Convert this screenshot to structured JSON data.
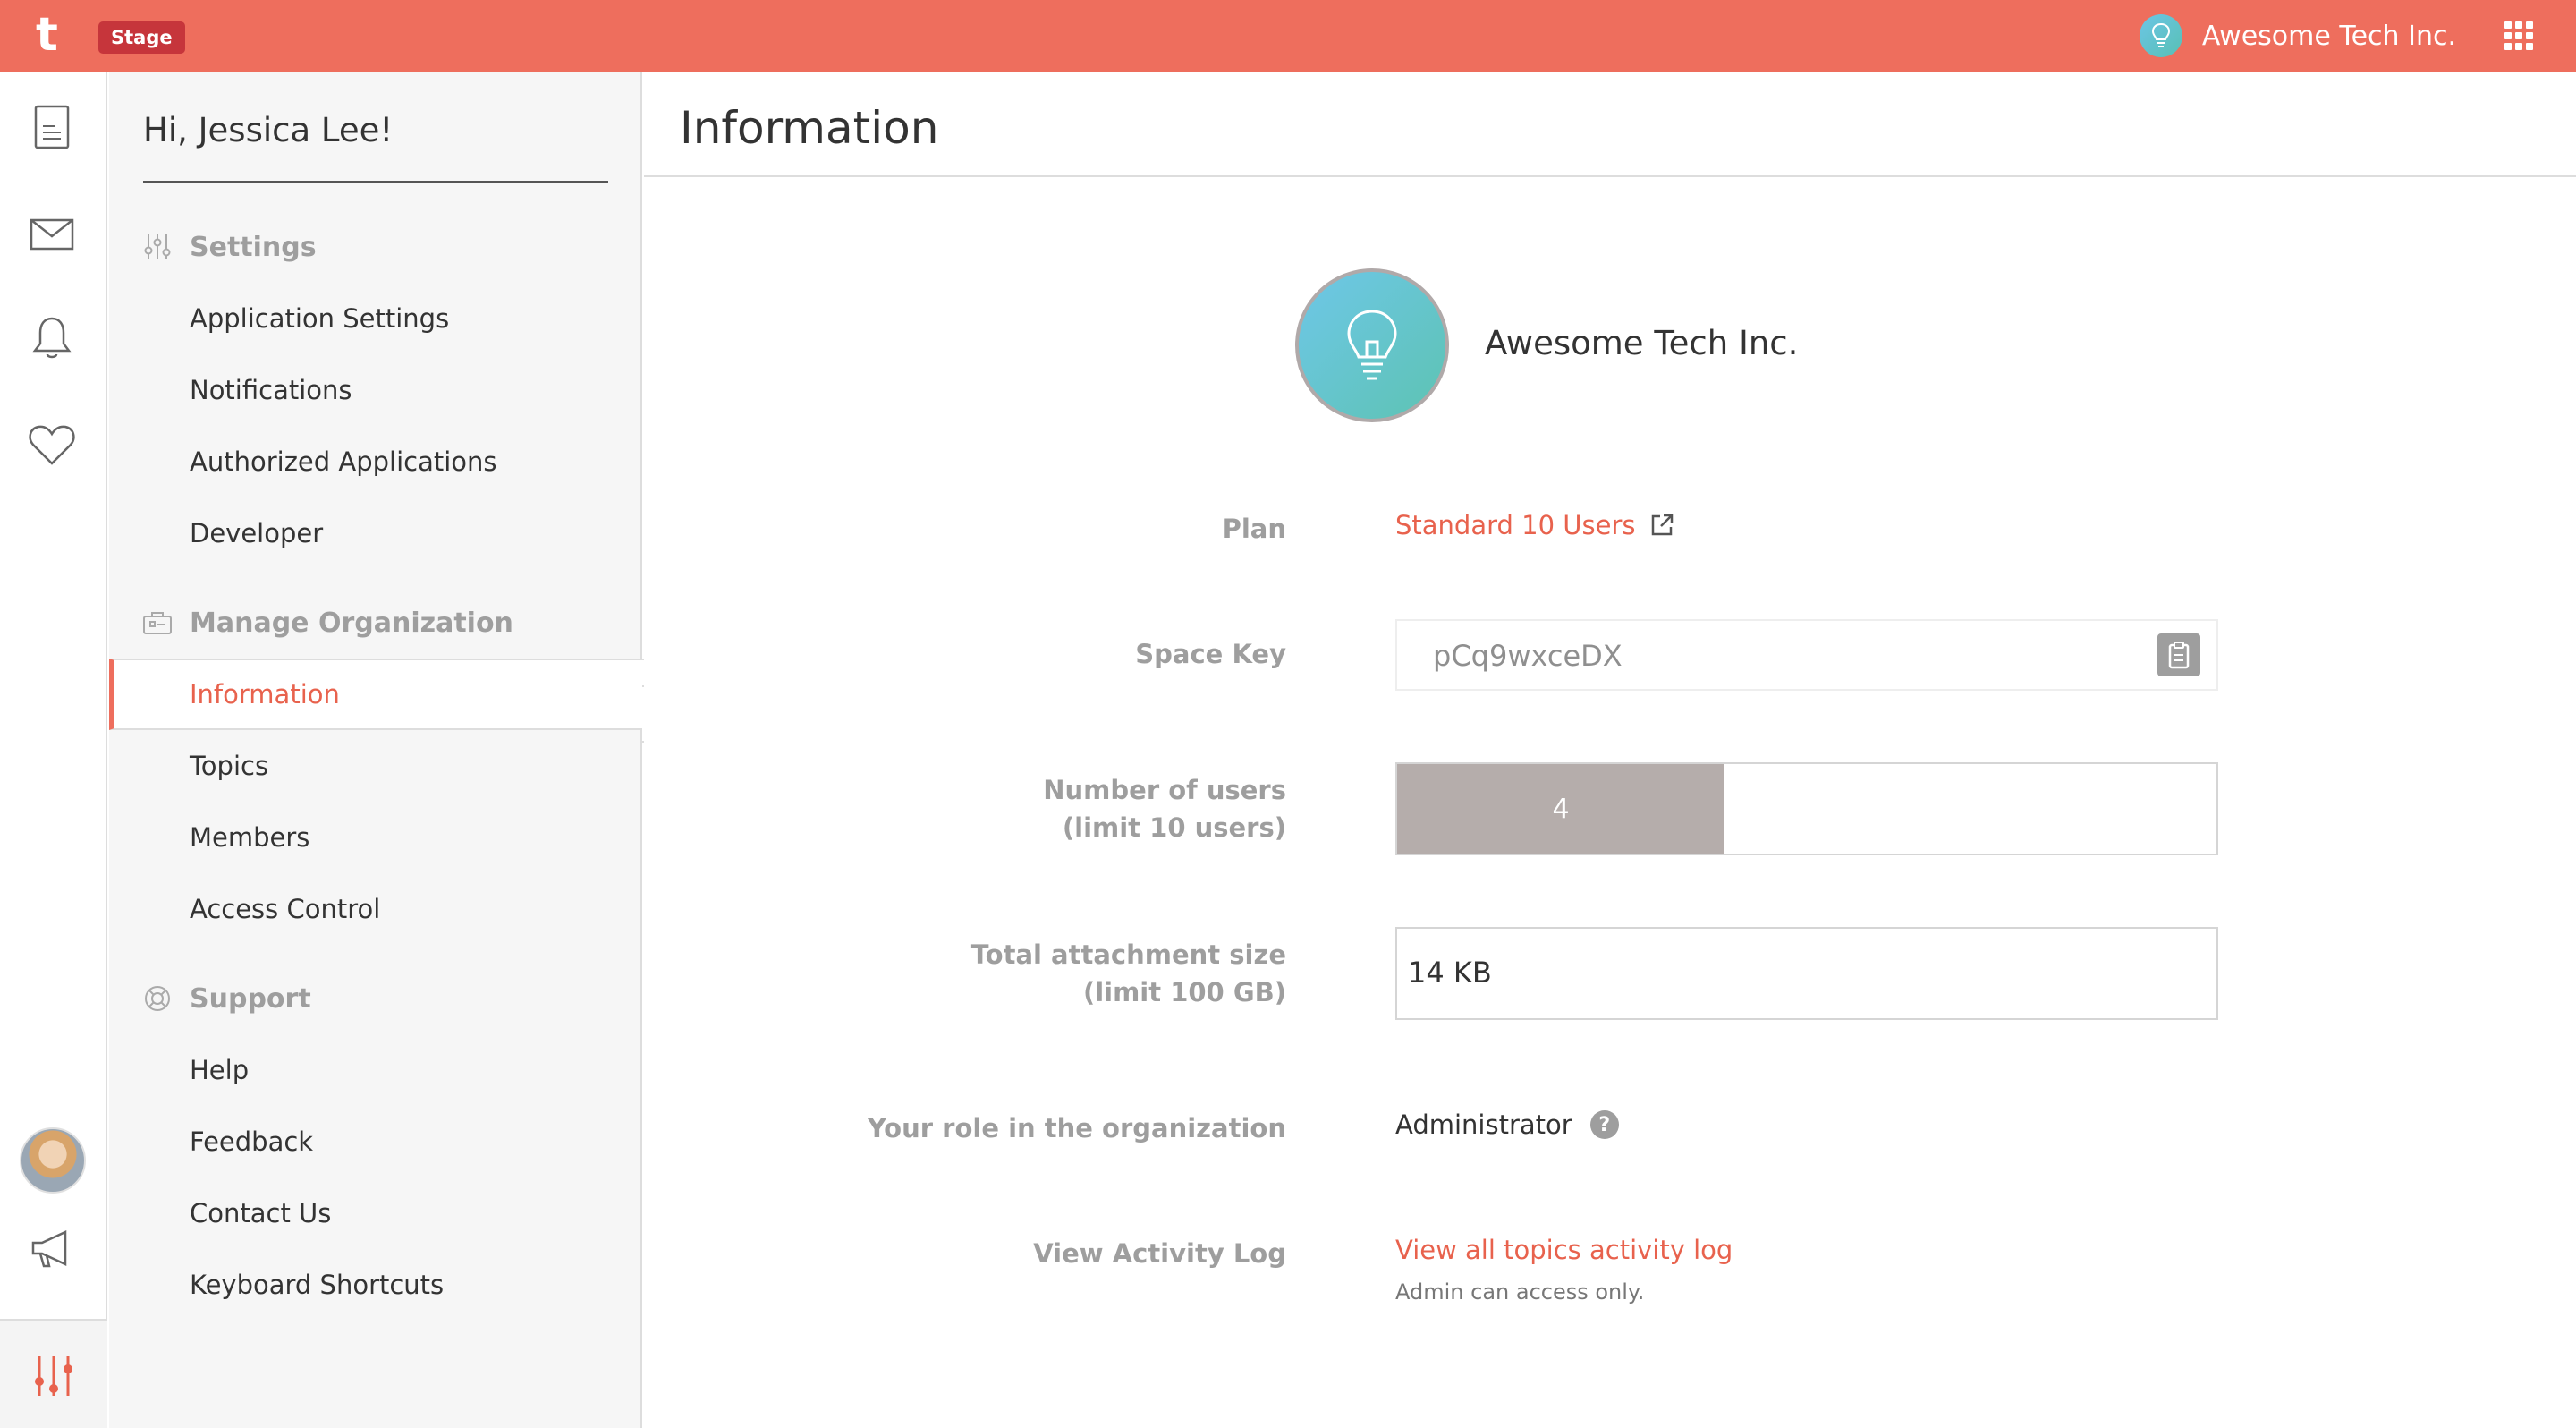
{
  "topbar": {
    "logo": "t",
    "env_badge": "Stage",
    "org_name": "Awesome Tech Inc."
  },
  "rail": {
    "icons": [
      "document-icon",
      "mail-icon",
      "bell-icon",
      "heart-icon",
      "megaphone-icon",
      "settings-sliders-icon"
    ]
  },
  "sidebar": {
    "greeting": "Hi, Jessica Lee!",
    "sections": [
      {
        "title": "Settings",
        "icon": "sliders-icon",
        "items": [
          "Application Settings",
          "Notifications",
          "Authorized Applications",
          "Developer"
        ]
      },
      {
        "title": "Manage Organization",
        "icon": "organization-icon",
        "items": [
          "Information",
          "Topics",
          "Members",
          "Access Control"
        ]
      },
      {
        "title": "Support",
        "icon": "lifebuoy-icon",
        "items": [
          "Help",
          "Feedback",
          "Contact Us",
          "Keyboard Shortcuts"
        ]
      }
    ],
    "active_item": "Information"
  },
  "main": {
    "title": "Information",
    "org_name": "Awesome Tech Inc.",
    "fields": {
      "plan": {
        "label": "Plan",
        "value": "Standard 10 Users"
      },
      "space_key": {
        "label": "Space Key",
        "value": "pCq9wxceDX"
      },
      "users": {
        "label_line1": "Number of users",
        "label_line2": "(limit 10 users)",
        "value": "4",
        "fraction": 0.4
      },
      "attachments": {
        "label_line1": "Total attachment size",
        "label_line2": "(limit 100 GB)",
        "value": "14 KB"
      },
      "role": {
        "label": "Your role in the organization",
        "value": "Administrator",
        "help": "?"
      },
      "activity": {
        "label": "View Activity Log",
        "link": "View all topics activity log",
        "note": "Admin can access only."
      }
    }
  },
  "colors": {
    "brand": "#ee6e5d",
    "accent_text": "#e8624d",
    "badge": "#c6353b",
    "muted": "#9e9e9e"
  }
}
